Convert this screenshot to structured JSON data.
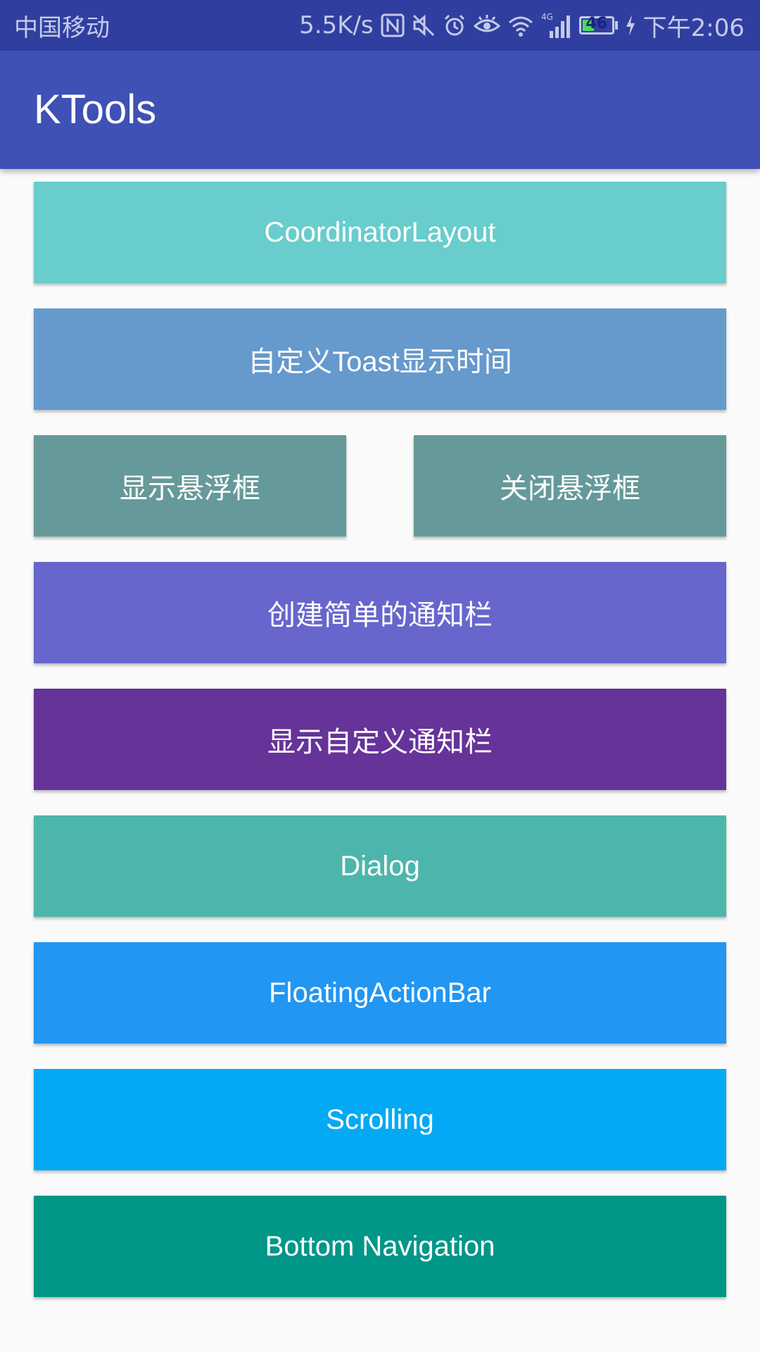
{
  "status_bar": {
    "carrier": "中国移动",
    "net_speed": "5.5K/s",
    "icons": [
      "nfc-icon",
      "mute-icon",
      "alarm-icon",
      "eye-comfort-icon",
      "wifi-icon",
      "signal-4g-icon",
      "battery-icon",
      "charging-icon"
    ],
    "network_type": "4G",
    "battery_level": "46",
    "time": "下午2:06"
  },
  "app_bar": {
    "title": "KTools"
  },
  "buttons": {
    "coordinator": {
      "label": "CoordinatorLayout",
      "color": "#68cdcc"
    },
    "toast": {
      "label": "自定义Toast显示时间",
      "color": "#6699cc"
    },
    "show_float": {
      "label": "显示悬浮框",
      "color": "#669999"
    },
    "close_float": {
      "label": "关闭悬浮框",
      "color": "#669999"
    },
    "simple_notification": {
      "label": "创建简单的通知栏",
      "color": "#6666cc"
    },
    "custom_notification": {
      "label": "显示自定义通知栏",
      "color": "#663399"
    },
    "dialog": {
      "label": "Dialog",
      "color": "#4db6ac"
    },
    "fab": {
      "label": "FloatingActionBar",
      "color": "#2196f3"
    },
    "scrolling": {
      "label": "Scrolling",
      "color": "#03a9f4"
    },
    "bottom_nav": {
      "label": "Bottom Navigation",
      "color": "#009688"
    }
  }
}
